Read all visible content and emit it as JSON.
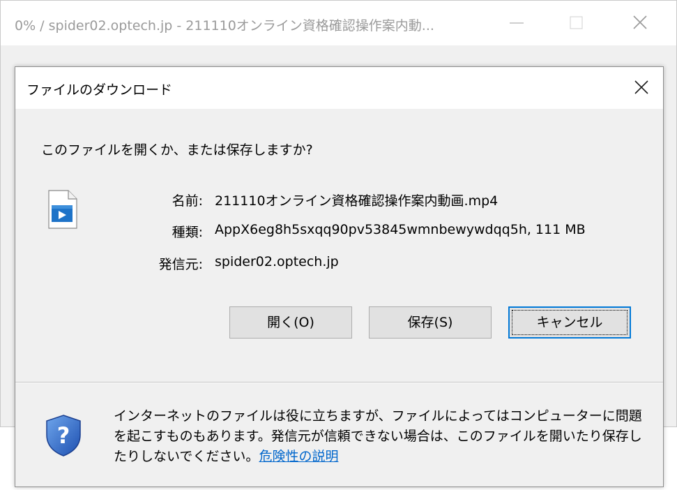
{
  "background_window": {
    "title": "0% / spider02.optech.jp - 211110オンライン資格確認操作案内動..."
  },
  "dialog": {
    "title": "ファイルのダウンロード",
    "question": "このファイルを開くか、または保存しますか?",
    "file": {
      "name_label": "名前:",
      "name_value": "211110オンライン資格確認操作案内動画.mp4",
      "type_label": "種類:",
      "type_value": "AppX6eg8h5sxqq90pv53845wmnbewywdqq5h, 111 MB",
      "from_label": "発信元:",
      "from_value": "spider02.optech.jp"
    },
    "buttons": {
      "open": "開く(O)",
      "save": "保存(S)",
      "cancel": "キャンセル"
    },
    "warning": {
      "text": "インターネットのファイルは役に立ちますが、ファイルによってはコンピューターに問題を起こすものもあります。発信元が信頼できない場合は、このファイルを開いたり保存したりしないでください。",
      "link": "危険性の説明"
    }
  },
  "colors": {
    "dialog_bg": "#f0f0f0",
    "titlebar_bg": "#ffffff",
    "button_bg": "#e1e1e1",
    "focus_border": "#0078d7",
    "link": "#0066cc"
  }
}
